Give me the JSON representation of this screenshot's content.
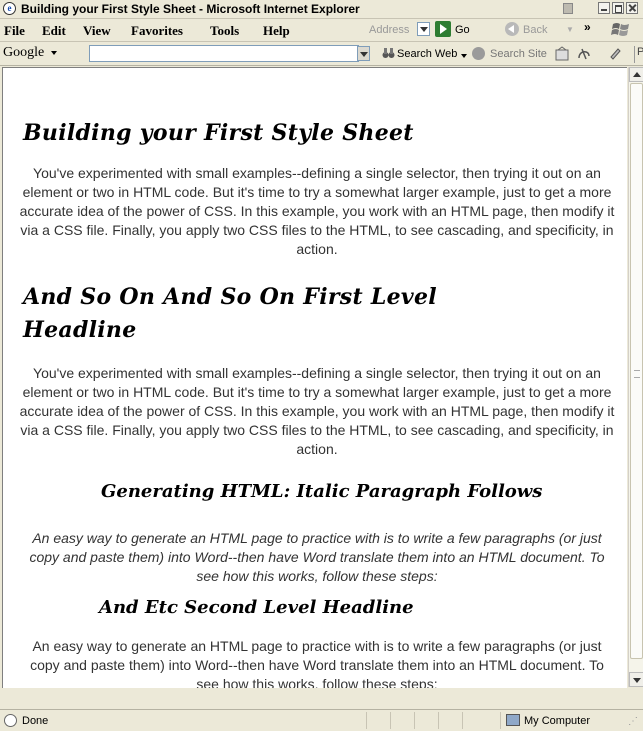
{
  "window": {
    "title": "Building your First Style Sheet - Microsoft Internet Explorer"
  },
  "menubar": {
    "items": [
      "File",
      "Edit",
      "View",
      "Favorites",
      "Tools",
      "Help"
    ],
    "address_label": "Address",
    "go_label": "Go",
    "back_label": "Back",
    "overflow_glyph": "»"
  },
  "google_toolbar": {
    "logo": "Google",
    "search_value": "",
    "search_web_label": "Search Web",
    "search_site_label": "Search Site",
    "page_label": "Pa"
  },
  "page": {
    "heading_1": "Building your First Style Sheet",
    "paragraph_1": "You've experimented with small examples--defining a single selector, then trying it out on an element or two in HTML code. But it's time to try a somewhat larger example, just to get a more accurate idea of the power of CSS. In this example, you work with an HTML page, then modify it via a CSS file. Finally, you apply two CSS files to the HTML, to see cascading, and specificity, in action.",
    "heading_2": "And So On And So On First Level Headline",
    "paragraph_2": "You've experimented with small examples--defining a single selector, then trying it out on an element or two in HTML code. But it's time to try a somewhat larger example, just to get a more accurate idea of the power of CSS. In this example, you work with an HTML page, then modify it via a CSS file. Finally, you apply two CSS files to the HTML, to see cascading, and specificity, in action.",
    "subheading_1": "Generating HTML: Italic Paragraph Follows",
    "paragraph_3": "An easy way to generate an HTML page to practice with is to write a few paragraphs (or just copy and paste them) into Word--then have Word translate them into an HTML document. To see how this works, follow these steps:",
    "subheading_2": "And Etc Second Level Headline",
    "paragraph_4": "An easy way to generate an HTML page to practice with is to write a few paragraphs (or just copy and paste them) into Word--then have Word translate them into an HTML document. To see how this works, follow these steps:"
  },
  "statusbar": {
    "status": "Done",
    "zone": "My Computer"
  },
  "icons": [
    "ie-page-icon",
    "minimize-icon",
    "maximize-icon",
    "close-icon",
    "go-arrow-icon",
    "back-arrow-icon",
    "windows-logo-icon",
    "binoculars-icon",
    "search-site-icon",
    "page-rank-icon",
    "autolink-icon",
    "scroll-up-icon",
    "scroll-down-icon",
    "computer-icon"
  ]
}
